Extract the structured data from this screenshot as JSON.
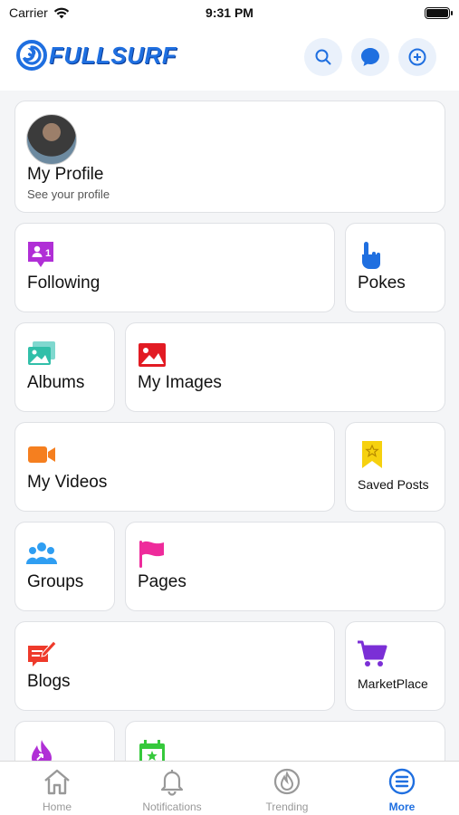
{
  "status_bar": {
    "carrier": "Carrier",
    "time": "9:31 PM"
  },
  "header": {
    "logo_text": "FULLSURF",
    "buttons": [
      "search-icon",
      "chat-bubble-icon",
      "add-circle-icon"
    ],
    "accent_color": "#1f6fe0"
  },
  "profile": {
    "title": "My Profile",
    "subtitle": "See your profile"
  },
  "menu": {
    "following": "Following",
    "pokes": "Pokes",
    "albums": "Albums",
    "my_images": "My Images",
    "my_videos": "My Videos",
    "saved_posts": "Saved Posts",
    "groups": "Groups",
    "pages": "Pages",
    "blogs": "Blogs",
    "marketplace": "MarketPlace"
  },
  "tabbar": {
    "home": "Home",
    "notifications": "Notifications",
    "trending": "Trending",
    "more": "More",
    "active": "More"
  }
}
